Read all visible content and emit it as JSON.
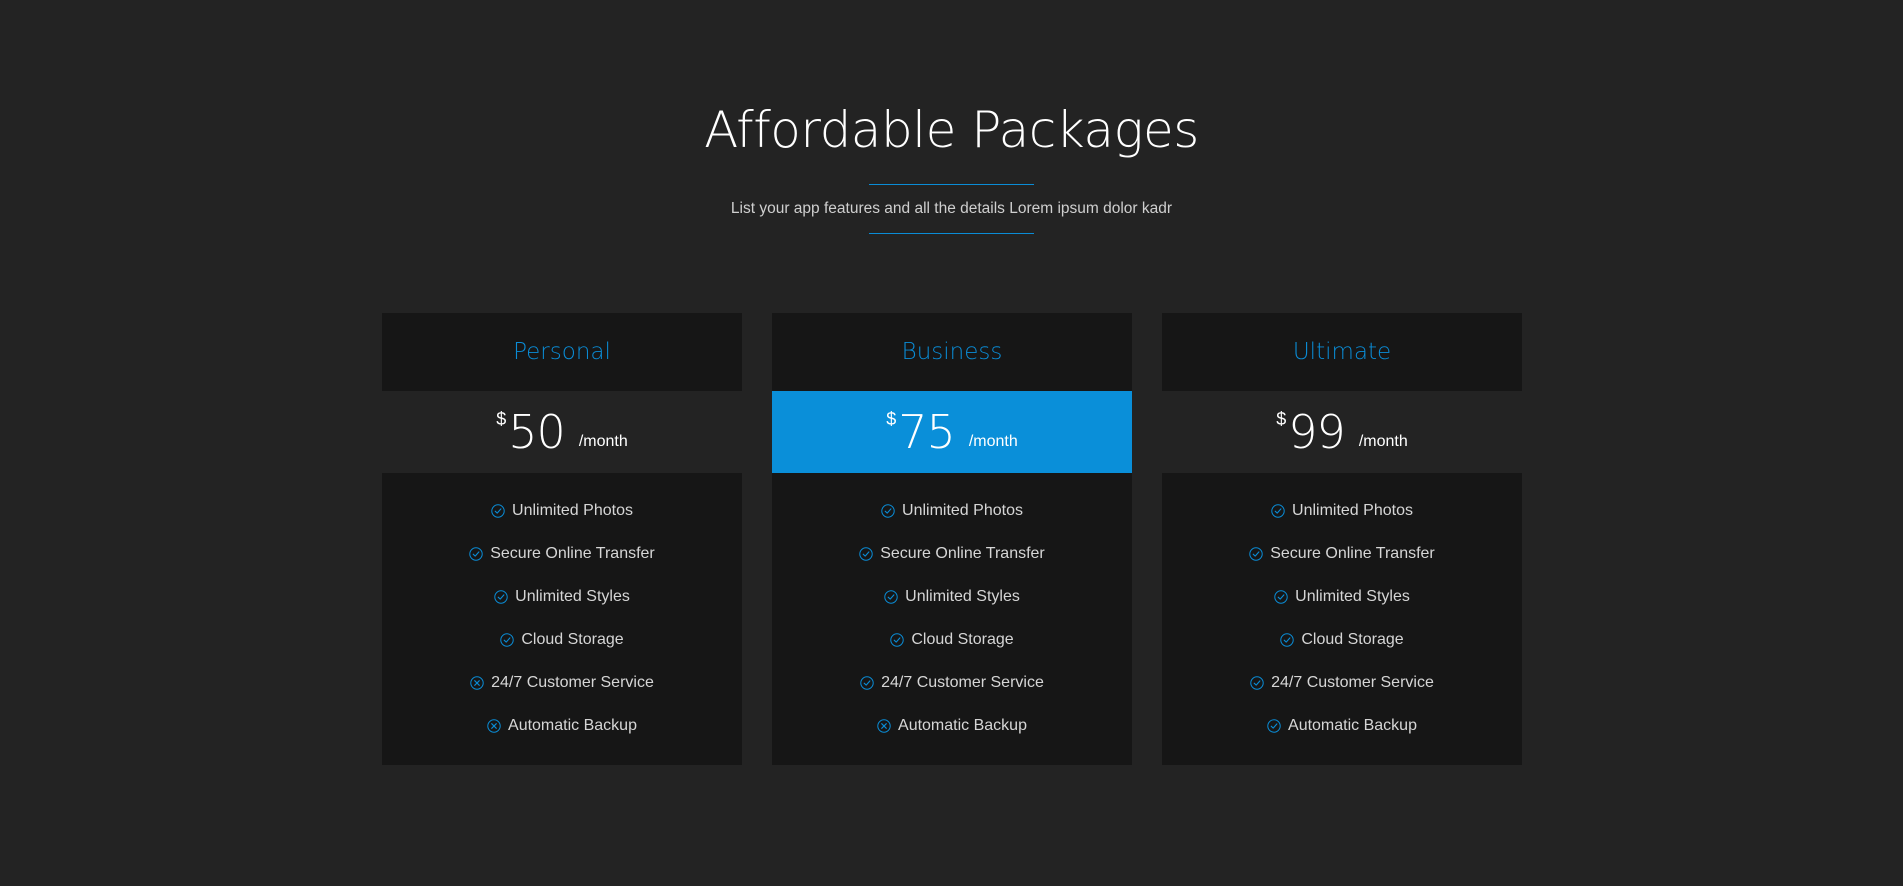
{
  "section": {
    "title": "Affordable Packages",
    "subtitle": "List your app features and all the details Lorem ipsum dolor kadr"
  },
  "colors": {
    "accent": "#0a8cd6",
    "background": "#232323",
    "card": "#161616"
  },
  "plans": [
    {
      "name": "Personal",
      "currency": "$",
      "amount": "50",
      "period": "/month",
      "featured": false,
      "features": [
        {
          "label": "Unlimited Photos",
          "icon": "check-circle-icon"
        },
        {
          "label": "Secure Online Transfer",
          "icon": "check-circle-icon"
        },
        {
          "label": "Unlimited Styles",
          "icon": "check-circle-icon"
        },
        {
          "label": "Cloud Storage",
          "icon": "check-circle-icon"
        },
        {
          "label": "24/7 Customer Service",
          "icon": "x-circle-icon"
        },
        {
          "label": "Automatic Backup",
          "icon": "x-circle-icon"
        }
      ]
    },
    {
      "name": "Business",
      "currency": "$",
      "amount": "75",
      "period": "/month",
      "featured": true,
      "features": [
        {
          "label": "Unlimited Photos",
          "icon": "check-circle-icon"
        },
        {
          "label": "Secure Online Transfer",
          "icon": "check-circle-icon"
        },
        {
          "label": "Unlimited Styles",
          "icon": "check-circle-icon"
        },
        {
          "label": "Cloud Storage",
          "icon": "check-circle-icon"
        },
        {
          "label": "24/7 Customer Service",
          "icon": "check-circle-icon"
        },
        {
          "label": "Automatic Backup",
          "icon": "x-circle-icon"
        }
      ]
    },
    {
      "name": "Ultimate",
      "currency": "$",
      "amount": "99",
      "period": "/month",
      "featured": false,
      "features": [
        {
          "label": "Unlimited Photos",
          "icon": "check-circle-icon"
        },
        {
          "label": "Secure Online Transfer",
          "icon": "check-circle-icon"
        },
        {
          "label": "Unlimited Styles",
          "icon": "check-circle-icon"
        },
        {
          "label": "Cloud Storage",
          "icon": "check-circle-icon"
        },
        {
          "label": "24/7 Customer Service",
          "icon": "check-circle-icon"
        },
        {
          "label": "Automatic Backup",
          "icon": "check-circle-icon"
        }
      ]
    }
  ]
}
